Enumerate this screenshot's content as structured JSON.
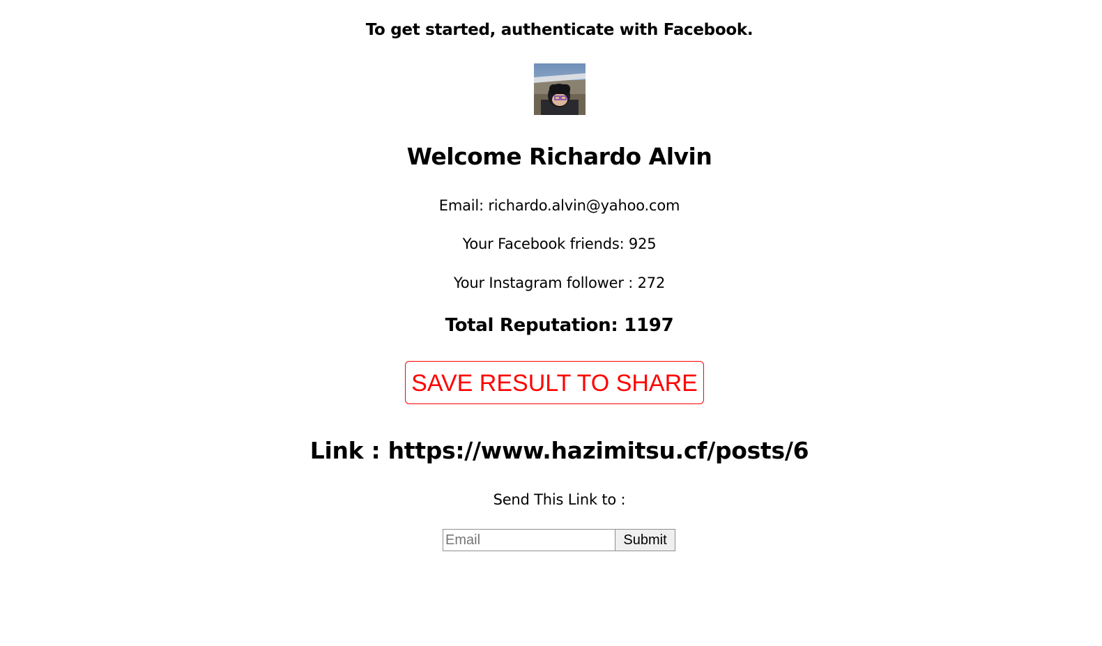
{
  "intro": {
    "text": "To get started, authenticate with Facebook."
  },
  "profile": {
    "avatar_icon": "user-profile-photo",
    "welcome": "Welcome Richardo Alvin",
    "email": "Email: richardo.alvin@yahoo.com",
    "facebook_friends": "Your Facebook friends: 925",
    "instagram_followers": "Your Instagram follower : 272",
    "total_reputation": "Total Reputation: 1197"
  },
  "actions": {
    "save_label": "SAVE RESULT TO SHARE",
    "save_color": "#ff0000"
  },
  "share": {
    "link_text": "Link : https://www.hazimitsu.cf/posts/6",
    "send_label": "Send This Link to :",
    "email_placeholder": "Email",
    "email_value": "",
    "submit_label": "Submit"
  }
}
